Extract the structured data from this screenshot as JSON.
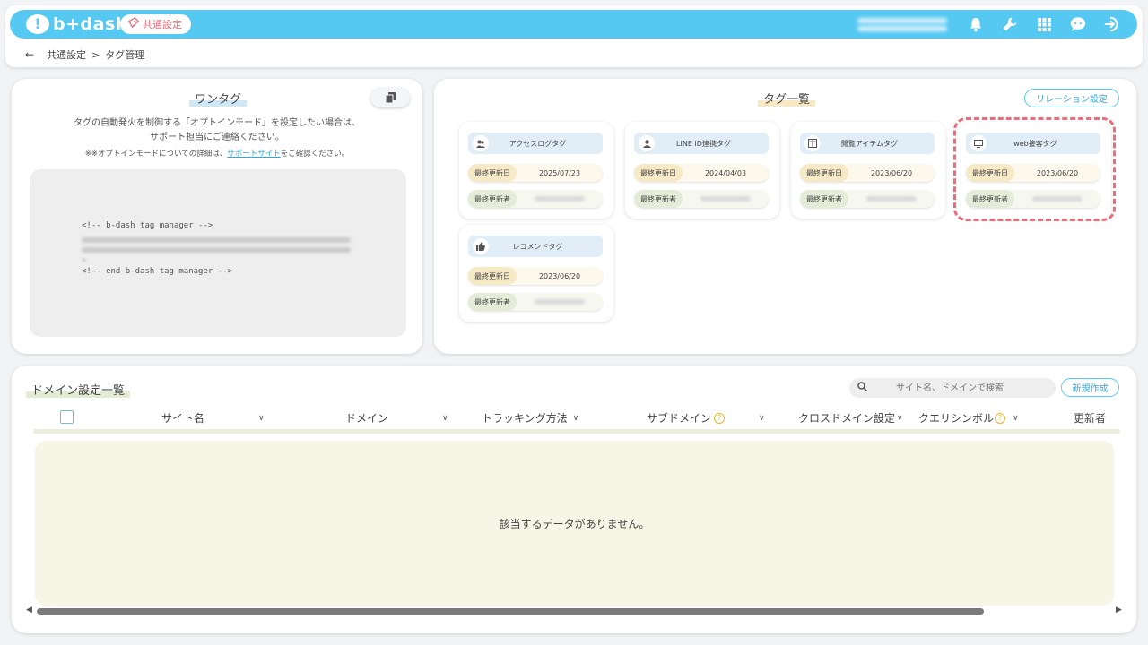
{
  "header": {
    "logo_text": "b+dash",
    "common_settings_label": "共通設定",
    "breadcrumb": [
      "共通設定",
      ">",
      "タグ管理"
    ],
    "icons": [
      "bell-icon",
      "wrench-icon",
      "apps-grid-icon",
      "chat-bot-icon",
      "logout-icon"
    ]
  },
  "onetag": {
    "title": "ワンタグ",
    "desc_line1": "タグの自動発火を制御する「オプトインモード」を設定したい場合は、",
    "desc_line2": "サポート担当にご連絡ください。",
    "note_prefix": "※※オプトインモードについての詳細は、",
    "note_link": "サポートサイト",
    "note_suffix": "をご確認ください。",
    "code_start": "<!-- b-dash tag manager -->",
    "code_end": "<!-- end b-dash tag manager -->",
    "code_close": ">"
  },
  "taglist": {
    "title": "タグ一覧",
    "relation_button": "リレーション設定",
    "label_updated": "最終更新日",
    "label_updater": "最終更新者",
    "tags": [
      {
        "name": "アクセスログタグ",
        "date": "2025/07/23"
      },
      {
        "name": "LINE ID連携タグ",
        "date": "2024/04/03"
      },
      {
        "name": "閲覧アイテムタグ",
        "date": "2023/06/20"
      },
      {
        "name": "web接客タグ",
        "date": "2023/06/20"
      },
      {
        "name": "レコメンドタグ",
        "date": "2023/06/20"
      }
    ]
  },
  "domain": {
    "title": "ドメイン設定一覧",
    "search_placeholder": "サイト名、ドメインで検索",
    "new_button": "新規作成",
    "columns": [
      "サイト名",
      "ドメイン",
      "トラッキング方法",
      "サブドメイン",
      "クロスドメイン設定",
      "クエリシンボル",
      "更新者"
    ],
    "empty_message": "該当するデータがありません。"
  }
}
